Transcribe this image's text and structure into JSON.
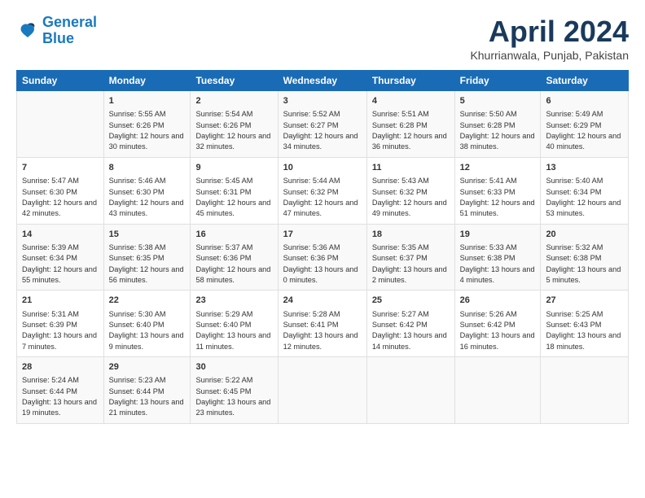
{
  "header": {
    "logo_line1": "General",
    "logo_line2": "Blue",
    "month_title": "April 2024",
    "subtitle": "Khurrianwala, Punjab, Pakistan"
  },
  "days_of_week": [
    "Sunday",
    "Monday",
    "Tuesday",
    "Wednesday",
    "Thursday",
    "Friday",
    "Saturday"
  ],
  "weeks": [
    [
      {
        "num": "",
        "info": ""
      },
      {
        "num": "1",
        "info": "Sunrise: 5:55 AM\nSunset: 6:26 PM\nDaylight: 12 hours\nand 30 minutes."
      },
      {
        "num": "2",
        "info": "Sunrise: 5:54 AM\nSunset: 6:26 PM\nDaylight: 12 hours\nand 32 minutes."
      },
      {
        "num": "3",
        "info": "Sunrise: 5:52 AM\nSunset: 6:27 PM\nDaylight: 12 hours\nand 34 minutes."
      },
      {
        "num": "4",
        "info": "Sunrise: 5:51 AM\nSunset: 6:28 PM\nDaylight: 12 hours\nand 36 minutes."
      },
      {
        "num": "5",
        "info": "Sunrise: 5:50 AM\nSunset: 6:28 PM\nDaylight: 12 hours\nand 38 minutes."
      },
      {
        "num": "6",
        "info": "Sunrise: 5:49 AM\nSunset: 6:29 PM\nDaylight: 12 hours\nand 40 minutes."
      }
    ],
    [
      {
        "num": "7",
        "info": "Sunrise: 5:47 AM\nSunset: 6:30 PM\nDaylight: 12 hours\nand 42 minutes."
      },
      {
        "num": "8",
        "info": "Sunrise: 5:46 AM\nSunset: 6:30 PM\nDaylight: 12 hours\nand 43 minutes."
      },
      {
        "num": "9",
        "info": "Sunrise: 5:45 AM\nSunset: 6:31 PM\nDaylight: 12 hours\nand 45 minutes."
      },
      {
        "num": "10",
        "info": "Sunrise: 5:44 AM\nSunset: 6:32 PM\nDaylight: 12 hours\nand 47 minutes."
      },
      {
        "num": "11",
        "info": "Sunrise: 5:43 AM\nSunset: 6:32 PM\nDaylight: 12 hours\nand 49 minutes."
      },
      {
        "num": "12",
        "info": "Sunrise: 5:41 AM\nSunset: 6:33 PM\nDaylight: 12 hours\nand 51 minutes."
      },
      {
        "num": "13",
        "info": "Sunrise: 5:40 AM\nSunset: 6:34 PM\nDaylight: 12 hours\nand 53 minutes."
      }
    ],
    [
      {
        "num": "14",
        "info": "Sunrise: 5:39 AM\nSunset: 6:34 PM\nDaylight: 12 hours\nand 55 minutes."
      },
      {
        "num": "15",
        "info": "Sunrise: 5:38 AM\nSunset: 6:35 PM\nDaylight: 12 hours\nand 56 minutes."
      },
      {
        "num": "16",
        "info": "Sunrise: 5:37 AM\nSunset: 6:36 PM\nDaylight: 12 hours\nand 58 minutes."
      },
      {
        "num": "17",
        "info": "Sunrise: 5:36 AM\nSunset: 6:36 PM\nDaylight: 13 hours\nand 0 minutes."
      },
      {
        "num": "18",
        "info": "Sunrise: 5:35 AM\nSunset: 6:37 PM\nDaylight: 13 hours\nand 2 minutes."
      },
      {
        "num": "19",
        "info": "Sunrise: 5:33 AM\nSunset: 6:38 PM\nDaylight: 13 hours\nand 4 minutes."
      },
      {
        "num": "20",
        "info": "Sunrise: 5:32 AM\nSunset: 6:38 PM\nDaylight: 13 hours\nand 5 minutes."
      }
    ],
    [
      {
        "num": "21",
        "info": "Sunrise: 5:31 AM\nSunset: 6:39 PM\nDaylight: 13 hours\nand 7 minutes."
      },
      {
        "num": "22",
        "info": "Sunrise: 5:30 AM\nSunset: 6:40 PM\nDaylight: 13 hours\nand 9 minutes."
      },
      {
        "num": "23",
        "info": "Sunrise: 5:29 AM\nSunset: 6:40 PM\nDaylight: 13 hours\nand 11 minutes."
      },
      {
        "num": "24",
        "info": "Sunrise: 5:28 AM\nSunset: 6:41 PM\nDaylight: 13 hours\nand 12 minutes."
      },
      {
        "num": "25",
        "info": "Sunrise: 5:27 AM\nSunset: 6:42 PM\nDaylight: 13 hours\nand 14 minutes."
      },
      {
        "num": "26",
        "info": "Sunrise: 5:26 AM\nSunset: 6:42 PM\nDaylight: 13 hours\nand 16 minutes."
      },
      {
        "num": "27",
        "info": "Sunrise: 5:25 AM\nSunset: 6:43 PM\nDaylight: 13 hours\nand 18 minutes."
      }
    ],
    [
      {
        "num": "28",
        "info": "Sunrise: 5:24 AM\nSunset: 6:44 PM\nDaylight: 13 hours\nand 19 minutes."
      },
      {
        "num": "29",
        "info": "Sunrise: 5:23 AM\nSunset: 6:44 PM\nDaylight: 13 hours\nand 21 minutes."
      },
      {
        "num": "30",
        "info": "Sunrise: 5:22 AM\nSunset: 6:45 PM\nDaylight: 13 hours\nand 23 minutes."
      },
      {
        "num": "",
        "info": ""
      },
      {
        "num": "",
        "info": ""
      },
      {
        "num": "",
        "info": ""
      },
      {
        "num": "",
        "info": ""
      }
    ]
  ]
}
